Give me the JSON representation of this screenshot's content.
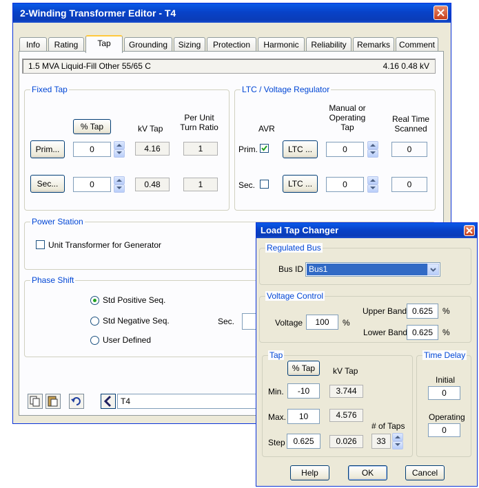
{
  "main_window": {
    "title": "2-Winding Transformer Editor - T4",
    "tabs": [
      "Info",
      "Rating",
      "Tap",
      "Grounding",
      "Sizing",
      "Protection",
      "Harmonic",
      "Reliability",
      "Remarks",
      "Comment"
    ],
    "active_tab": "Tap",
    "info_left": "1.5 MVA  Liquid-Fill  Other  55/65 C",
    "info_right": "4.16   0.48 kV",
    "fixed_tap": {
      "label": "Fixed Tap",
      "pct_tap_button": "% Tap",
      "kv_tap_header": "kV Tap",
      "per_unit_header": "Per Unit\nTurn Ratio",
      "prim_button": "Prim...",
      "sec_button": "Sec...",
      "prim_tap": "0",
      "sec_tap": "0",
      "prim_kv": "4.16",
      "sec_kv": "0.48",
      "prim_ratio": "1",
      "sec_ratio": "1"
    },
    "ltc": {
      "label": "LTC / Voltage Regulator",
      "avr_header": "AVR",
      "manual_header": "Manual or\nOperating\nTap",
      "realtime_header": "Real Time\nScanned",
      "prim_label": "Prim.",
      "sec_label": "Sec.",
      "prim_checked": true,
      "sec_checked": false,
      "ltc_button": "LTC ...",
      "prim_tap": "0",
      "sec_tap": "0",
      "prim_scanned": "0",
      "sec_scanned": "0"
    },
    "power_station": {
      "label": "Power Station",
      "unit_transformer": "Unit Transformer for Generator"
    },
    "phase_shift": {
      "label": "Phase Shift",
      "options": [
        "Std Positive Seq.",
        "Std Negative Seq.",
        "User Defined"
      ],
      "selected": "Std Positive Seq.",
      "sec_label": "Sec."
    },
    "footer_id": "T4"
  },
  "dialog": {
    "title": "Load Tap Changer",
    "regulated_bus": {
      "label": "Regulated Bus",
      "bus_id_label": "Bus ID",
      "bus_id_value": "Bus1"
    },
    "voltage_control": {
      "label": "Voltage Control",
      "voltage_label": "Voltage",
      "voltage_value": "100",
      "voltage_unit": "%",
      "upper_band_label": "Upper Band",
      "upper_band_value": "0.625",
      "upper_unit": "%",
      "lower_band_label": "Lower Band",
      "lower_band_value": "0.625",
      "lower_unit": "%"
    },
    "tap": {
      "label": "Tap",
      "pct_tap_button": "% Tap",
      "kv_tap_header": "kV Tap",
      "min_label": "Min.",
      "max_label": "Max.",
      "step_label": "Step",
      "min_value": "-10",
      "max_value": "10",
      "step_value": "0.625",
      "min_kv": "3.744",
      "max_kv": "4.576",
      "step_kv": "0.026",
      "num_taps_label": "# of Taps",
      "num_taps_value": "33"
    },
    "time_delay": {
      "label": "Time Delay",
      "initial_label": "Initial",
      "initial_value": "0",
      "operating_label": "Operating",
      "operating_value": "0"
    },
    "buttons": {
      "help": "Help",
      "ok": "OK",
      "cancel": "Cancel"
    }
  },
  "colors": {
    "title_bar": "#0842c8",
    "group_label": "#0046d5",
    "selection": "#316ac5",
    "window_bg": "#ece9d8"
  }
}
